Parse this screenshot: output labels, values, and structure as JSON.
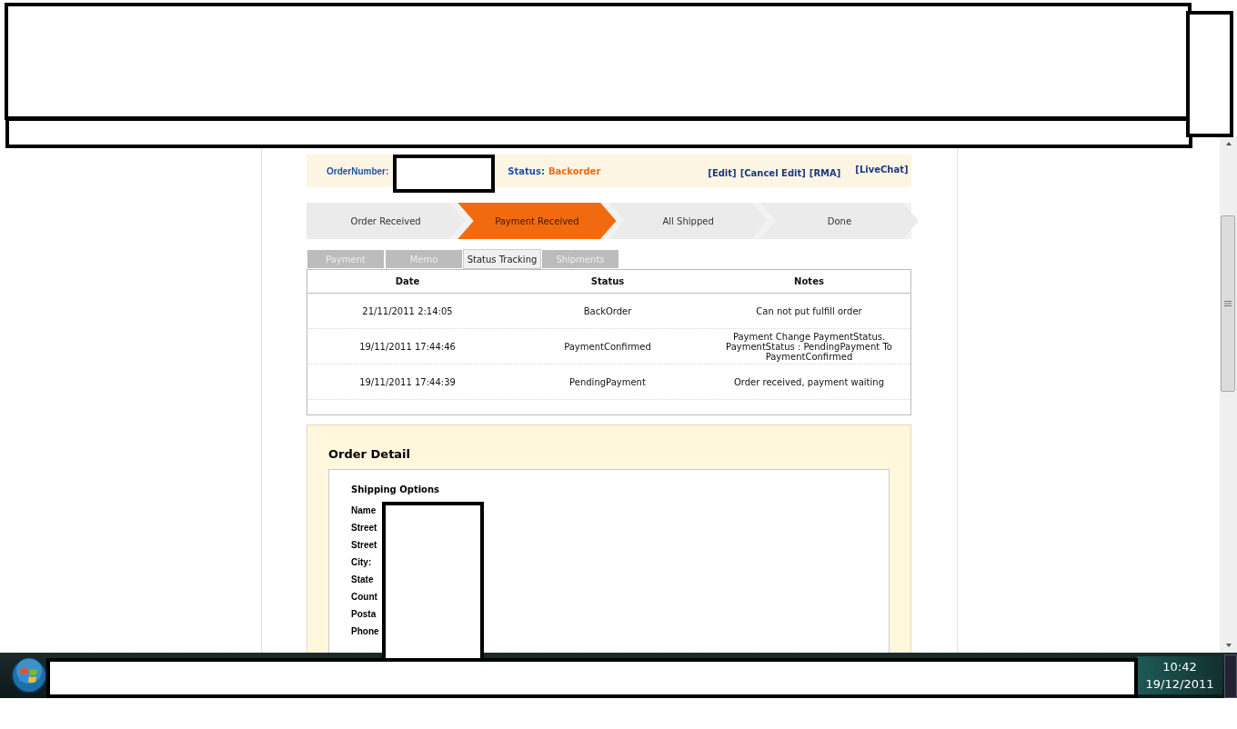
{
  "order_header": {
    "order_number_label": "OrderNumber:",
    "status_label": "Status:",
    "status_value": "Backorder",
    "links": [
      "[Edit]",
      "[Cancel Edit]",
      "[RMA]"
    ],
    "live_chat": "[LiveChat]"
  },
  "steps": [
    {
      "label": "Order Received",
      "selected": false
    },
    {
      "label": "Payment Received",
      "selected": true
    },
    {
      "label": "All Shipped",
      "selected": false
    },
    {
      "label": "Done",
      "selected": false
    }
  ],
  "tabs": [
    {
      "label": "Payment",
      "selected": false
    },
    {
      "label": "Memo",
      "selected": false
    },
    {
      "label": "Status Tracking",
      "selected": true
    },
    {
      "label": "Shipments",
      "selected": false
    }
  ],
  "tracking_table": {
    "columns": [
      "Date",
      "Status",
      "Notes"
    ],
    "rows": [
      {
        "date": "21/11/2011 2:14:05",
        "status": "BackOrder",
        "notes": "Can not put fulfill order"
      },
      {
        "date": "19/11/2011 17:44:46",
        "status": "PaymentConfirmed",
        "notes": "Payment Change PaymentStatus. PaymentStatus : PendingPayment To PaymentConfirmed"
      },
      {
        "date": "19/11/2011 17:44:39",
        "status": "PendingPayment",
        "notes": "Order received, payment waiting"
      }
    ]
  },
  "order_detail": {
    "title": "Order Detail",
    "section_title": "Shipping Options",
    "field_labels": [
      "Name",
      "Street",
      "Street",
      "City:",
      "State",
      "Count",
      "Posta",
      "Phone"
    ]
  },
  "taskbar": {
    "time": "10:42",
    "date": "19/12/2011"
  }
}
